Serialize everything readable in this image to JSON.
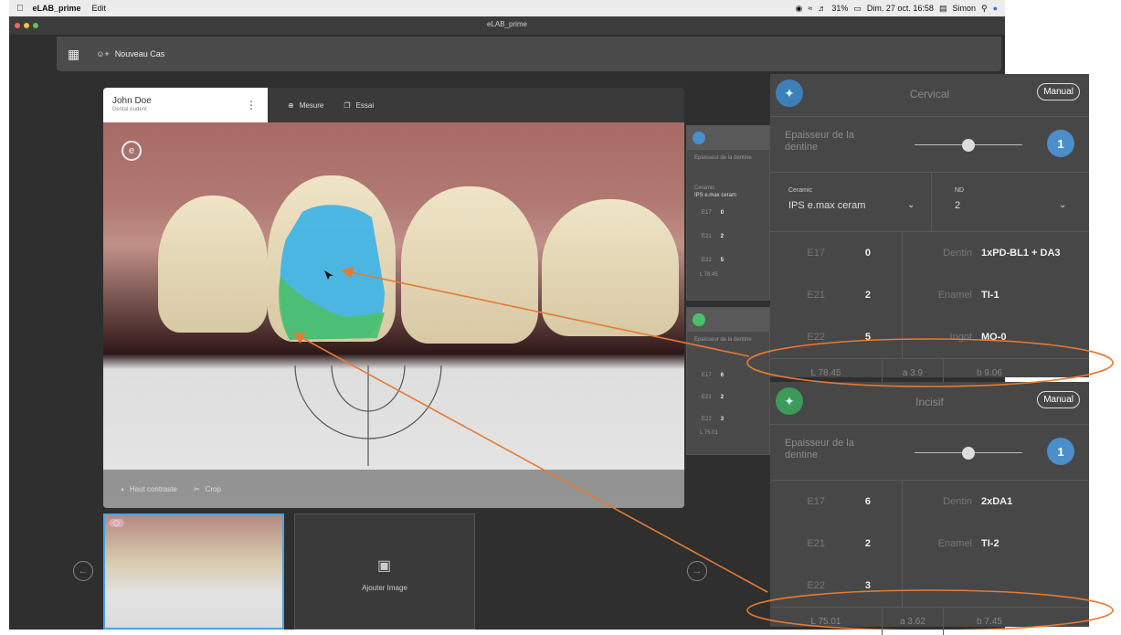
{
  "menubar": {
    "app_name": "eLAB_prime",
    "edit": "Edit",
    "battery": "31%",
    "datetime": "Dim. 27 oct. 16:58",
    "user": "Simon"
  },
  "window": {
    "title": "eLAB_prime"
  },
  "toolbar": {
    "new_case": "Nouveau Cas"
  },
  "patient": {
    "name": "John Doe",
    "subtitle": "Dental Audent"
  },
  "photo_tools": {
    "measure": "Mesure",
    "trial": "Essai",
    "high_contrast": "Haut contraste",
    "crop": "Crop"
  },
  "thumbnails": {
    "add_image": "Ajouter Image"
  },
  "mini_panel_1": {
    "label": "Epaisseur de la dentine",
    "ceramic_label": "Ceramic",
    "ceramic_value": "IPS e.max ceram",
    "rows": [
      {
        "k": "E17",
        "v": "0"
      },
      {
        "k": "E21",
        "v": "2"
      },
      {
        "k": "E22",
        "v": "5"
      }
    ],
    "lab_l": "L 78.45"
  },
  "mini_panel_2": {
    "label": "Epaisseur de la dentine",
    "rows": [
      {
        "k": "E17",
        "v": "6"
      },
      {
        "k": "E21",
        "v": "2"
      },
      {
        "k": "E22",
        "v": "3"
      }
    ],
    "lab_l": "L 75.01"
  },
  "cervical": {
    "title": "Cervical",
    "manual": "Manual",
    "thickness_label": "Epaisseur de la dentine",
    "thickness_value": "1",
    "ceramic_label": "Ceramic",
    "ceramic_value": "IPS e.max ceram",
    "nd_label": "ND",
    "nd_value": "2",
    "rows": [
      {
        "k": "E17",
        "v": "0",
        "k2": "Dentin",
        "v2": "1xPD-BL1 + DA3"
      },
      {
        "k": "E21",
        "v": "2",
        "k2": "Enamel",
        "v2": "TI-1"
      },
      {
        "k": "E22",
        "v": "5",
        "k2": "Ingot",
        "v2": "MO-0"
      }
    ],
    "lab": {
      "l": "L 78.45",
      "a": "a 3.9",
      "b": "b 9.06"
    }
  },
  "incisif": {
    "title": "Incisif",
    "manual": "Manual",
    "thickness_label": "Epaisseur de la dentine",
    "thickness_value": "1",
    "rows": [
      {
        "k": "E17",
        "v": "6",
        "k2": "Dentin",
        "v2": "2xDA1"
      },
      {
        "k": "E21",
        "v": "2",
        "k2": "Enamel",
        "v2": "TI-2"
      },
      {
        "k": "E22",
        "v": "3",
        "k2": "",
        "v2": ""
      }
    ],
    "lab": {
      "l": "L 75.01",
      "a": "a 3.62",
      "b": "b 7.45"
    }
  },
  "colors": {
    "accent": "#4aa3df",
    "annotation": "#e57a33",
    "shade_blue": "#3fb3e6",
    "shade_green": "#4cbf6a"
  }
}
